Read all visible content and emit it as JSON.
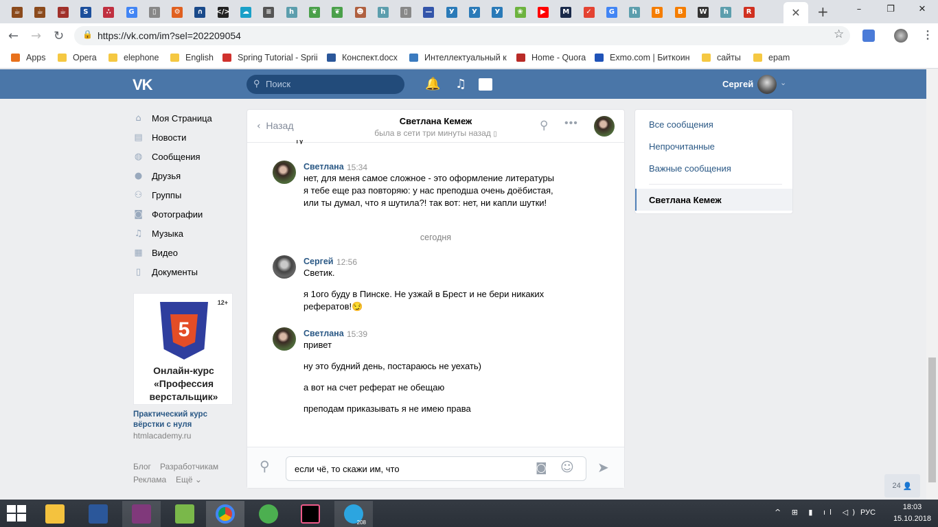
{
  "browser": {
    "url": "https://vk.com/im?sel=202209054",
    "tab_count_icons": [
      {
        "icon": "coffee-icon",
        "color": "#8b4a1c"
      },
      {
        "icon": "coffee-icon",
        "color": "#8b4a1c"
      },
      {
        "icon": "cup-icon",
        "color": "#a0302a"
      },
      {
        "icon": "sqlru-icon",
        "color": "#1c4f9c"
      },
      {
        "icon": "network-icon",
        "color": "#c03040"
      },
      {
        "icon": "google-icon",
        "color": "#4285f4"
      },
      {
        "icon": "page-icon",
        "color": "#888888"
      },
      {
        "icon": "gear-icon",
        "color": "#e06020"
      },
      {
        "icon": "archlinux-icon",
        "color": "#1a4a8a"
      },
      {
        "icon": "code-icon",
        "color": "#222222"
      },
      {
        "icon": "cloud-icon",
        "color": "#1aa0c8"
      },
      {
        "icon": "list-icon",
        "color": "#555555"
      },
      {
        "icon": "h-icon",
        "color": "#5c9ead"
      },
      {
        "icon": "leaf-icon",
        "color": "#4aa04a"
      },
      {
        "icon": "leaf-icon",
        "color": "#4aa04a"
      },
      {
        "icon": "face-icon",
        "color": "#b06040"
      },
      {
        "icon": "h-icon",
        "color": "#5c9ead"
      },
      {
        "icon": "page-icon",
        "color": "#888888"
      },
      {
        "icon": "dash-icon",
        "color": "#3355aa"
      },
      {
        "icon": "yandex-icon",
        "color": "#2a7ab8"
      },
      {
        "icon": "yandex-icon",
        "color": "#2a7ab8"
      },
      {
        "icon": "yandex-icon",
        "color": "#2a7ab8"
      },
      {
        "icon": "spring-icon",
        "color": "#6db33f"
      },
      {
        "icon": "youtube-icon",
        "color": "#ff0000"
      },
      {
        "icon": "m-icon",
        "color": "#1a2a4a"
      },
      {
        "icon": "check-icon",
        "color": "#e44332"
      },
      {
        "icon": "google-icon",
        "color": "#4285f4"
      },
      {
        "icon": "h-icon",
        "color": "#5c9ead"
      },
      {
        "icon": "blogger-icon",
        "color": "#f57d00"
      },
      {
        "icon": "blogger-icon",
        "color": "#f57d00"
      },
      {
        "icon": "wikipedia-icon",
        "color": "#333333"
      },
      {
        "icon": "h-icon",
        "color": "#5c9ead"
      },
      {
        "icon": "r-icon",
        "color": "#d03020"
      }
    ],
    "bookmarks": [
      {
        "label": "Apps",
        "icon": "apps-grid-icon"
      },
      {
        "label": "Opera",
        "icon": "folder-icon"
      },
      {
        "label": "elephone",
        "icon": "folder-icon"
      },
      {
        "label": "English",
        "icon": "folder-icon"
      },
      {
        "label": "Spring Tutorial - Sprii",
        "icon": "spring-icon"
      },
      {
        "label": "Конспект.docx",
        "icon": "word-icon"
      },
      {
        "label": "Интеллектуальный к",
        "icon": "globe-icon"
      },
      {
        "label": "Home - Quora",
        "icon": "quora-icon"
      },
      {
        "label": "Exmo.com | Биткоин",
        "icon": "exmo-icon"
      },
      {
        "label": "сайты",
        "icon": "folder-icon"
      },
      {
        "label": "epam",
        "icon": "folder-icon"
      }
    ]
  },
  "header": {
    "logo": "VK",
    "search_placeholder": "Поиск",
    "user_name": "Сергей"
  },
  "left_menu": [
    {
      "label": "Моя Страница",
      "icon": "home-icon"
    },
    {
      "label": "Новости",
      "icon": "news-icon"
    },
    {
      "label": "Сообщения",
      "icon": "messages-icon"
    },
    {
      "label": "Друзья",
      "icon": "friends-icon"
    },
    {
      "label": "Группы",
      "icon": "groups-icon"
    },
    {
      "label": "Фотографии",
      "icon": "camera-icon"
    },
    {
      "label": "Музыка",
      "icon": "music-icon"
    },
    {
      "label": "Видео",
      "icon": "video-icon"
    },
    {
      "label": "Документы",
      "icon": "documents-icon"
    }
  ],
  "ad": {
    "age": "12+",
    "badge_text": "5",
    "image_text": "Онлайн-курс «Профессия верстальщик»",
    "title": "Практический курс вёрстки с нуля",
    "domain": "htmlacademy.ru"
  },
  "footer_links": [
    "Блог",
    "Разработчикам",
    "Реклама",
    "Ещё ⌄"
  ],
  "chat": {
    "back_label": "Назад",
    "title": "Светлана Кемеж",
    "status": "была в сети три минуты назад",
    "date_separator": "сегодня",
    "messages": [
      {
        "sender": "Светлана",
        "time": "15:34",
        "lines": [
          "нет, для меня самое сложное - это оформление литературы",
          "я тебе еще раз повторяю: у нас преподша очень доёбистая,",
          "или ты думал, что я шутила?! так вот: нет, ни капли шутки!"
        ]
      },
      {
        "sender": "Сергей",
        "time": "12:56",
        "lines": [
          "Светик.",
          "я 1ого буду в Пинске. Не узжай в Брест и не бери никаких",
          "рефератов!😏"
        ]
      },
      {
        "sender": "Светлана",
        "time": "15:39",
        "lines": [
          "привет",
          "ну это будний день, постараюсь не уехать)",
          "а вот на счет реферат не обещаю",
          "преподам приказывать я не имею права"
        ]
      }
    ],
    "draft": "если чё, то скажи им, что"
  },
  "right_panel": {
    "links": [
      "Все сообщения",
      "Непрочитанные",
      "Важные сообщения"
    ],
    "selected": "Светлана Кемеж"
  },
  "online_counter": "24",
  "taskbar": {
    "language": "РУС",
    "time": "18:03",
    "date": "15.10.2018",
    "telegram_badge": "208"
  }
}
